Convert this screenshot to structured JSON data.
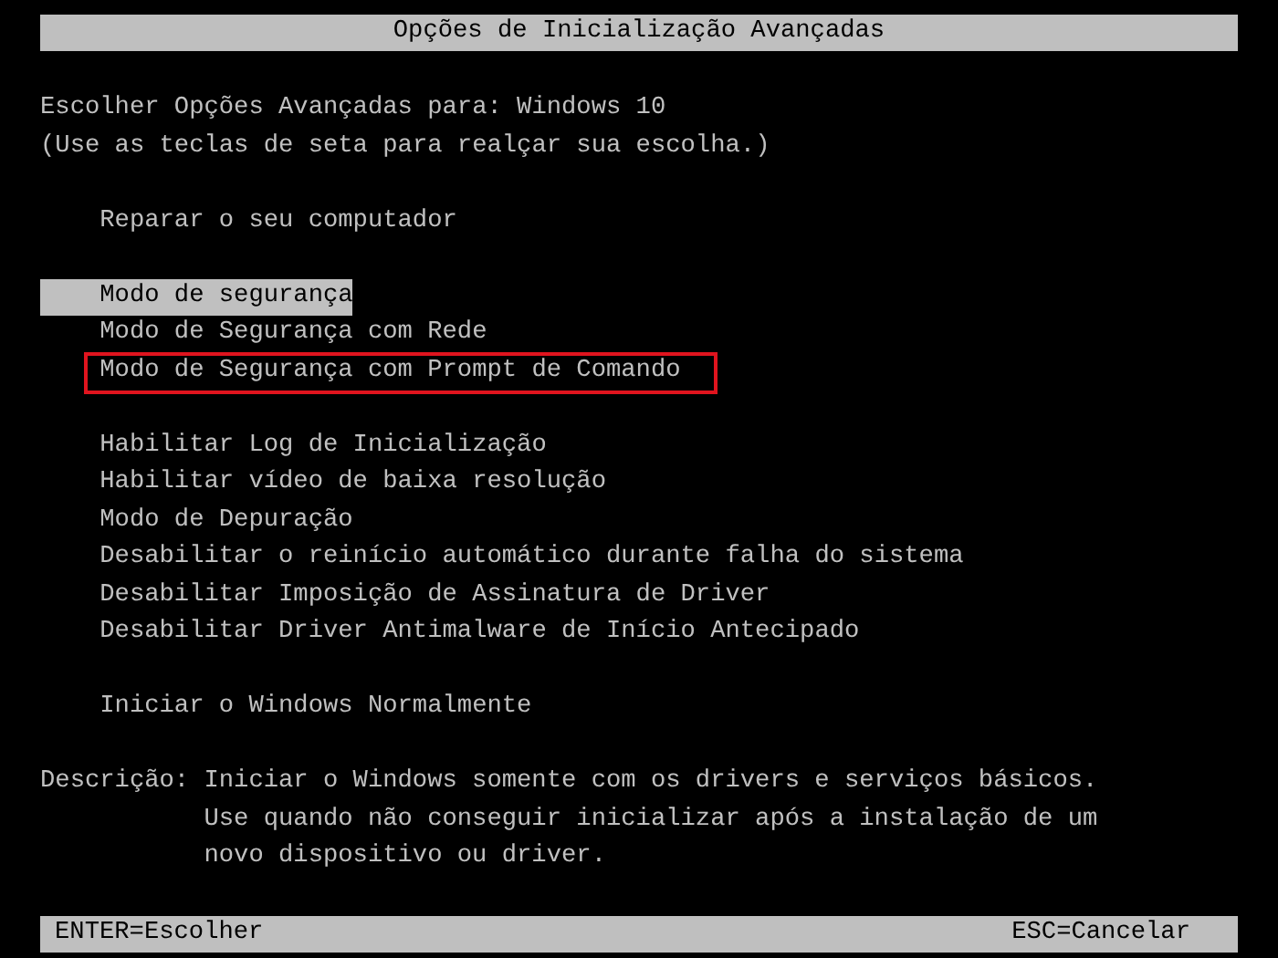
{
  "title_bar": {
    "title": "Opções de Inicialização Avançadas"
  },
  "header": [
    "Escolher Opções Avançadas para: Windows 10",
    "(Use as teclas de seta para realçar sua escolha.)"
  ],
  "menu_groups": [
    {
      "items": [
        {
          "label": "Reparar o seu computador",
          "selected": false,
          "outlined": false
        }
      ]
    },
    {
      "items": [
        {
          "label": "Modo de segurança",
          "selected": true,
          "outlined": false
        },
        {
          "label": "Modo de Segurança com Rede",
          "selected": false,
          "outlined": false
        },
        {
          "label": "Modo de Segurança com Prompt de Comando",
          "selected": false,
          "outlined": true
        }
      ]
    },
    {
      "items": [
        {
          "label": "Habilitar Log de Inicialização",
          "selected": false,
          "outlined": false
        },
        {
          "label": "Habilitar vídeo de baixa resolução",
          "selected": false,
          "outlined": false
        },
        {
          "label": "Modo de Depuração",
          "selected": false,
          "outlined": false
        },
        {
          "label": "Desabilitar o reinício automático durante falha do sistema",
          "selected": false,
          "outlined": false
        },
        {
          "label": "Desabilitar Imposição de Assinatura de Driver",
          "selected": false,
          "outlined": false
        },
        {
          "label": "Desabilitar Driver Antimalware de Início Antecipado",
          "selected": false,
          "outlined": false
        }
      ]
    },
    {
      "items": [
        {
          "label": "Iniciar o Windows Normalmente",
          "selected": false,
          "outlined": false
        }
      ]
    }
  ],
  "description": {
    "label": "Descrição:",
    "lines": [
      "Iniciar o Windows somente com os drivers e serviços básicos.",
      "Use quando não conseguir inicializar após a instalação de um",
      "novo dispositivo ou driver."
    ]
  },
  "status_bar": {
    "left": "ENTER=Escolher",
    "right": "ESC=Cancelar"
  }
}
